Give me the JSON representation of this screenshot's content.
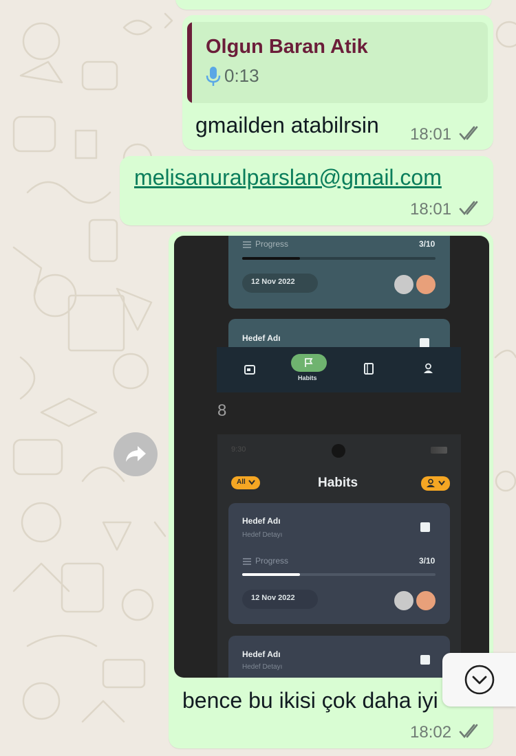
{
  "messages": {
    "reply_bubble": {
      "quoted_sender": "Olgun Baran Atik",
      "quoted_voice_duration": "0:13",
      "text": "gmailden atabilrsin",
      "time": "18:01"
    },
    "email_bubble": {
      "email": "melisanuralparslan@gmail.com",
      "time": "18:01"
    },
    "image_bubble": {
      "caption": "bence bu ikisi çok daha iyi",
      "time": "18:02"
    }
  },
  "screenshot": {
    "top_card": {
      "progress_label": "Progress",
      "progress_count": "3/10",
      "progress_fraction": 0.3,
      "date": "12 Nov 2022",
      "next_card_title": "Hedef Adı"
    },
    "nav": {
      "active_label": "Habits",
      "icons": [
        "calendar-icon",
        "flag-icon",
        "book-icon",
        "person-icon"
      ]
    },
    "page_number": "8",
    "phone": {
      "status_time": "9:30",
      "filter_chip": "All",
      "title": "Habits",
      "card1": {
        "title": "Hedef Adı",
        "subtitle": "Hedef Detayı",
        "progress_label": "Progress",
        "progress_count": "3/10",
        "progress_fraction": 0.3,
        "date": "12 Nov 2022"
      },
      "card2": {
        "title": "Hedef Adı",
        "subtitle": "Hedef Detayı"
      }
    }
  },
  "colors": {
    "bubble": "#d9fdd3",
    "chat_background": "#efeae2",
    "quote_accent": "#6b1e3a",
    "read_ticks": "#6f7b74",
    "chip_orange": "#f5a623"
  }
}
